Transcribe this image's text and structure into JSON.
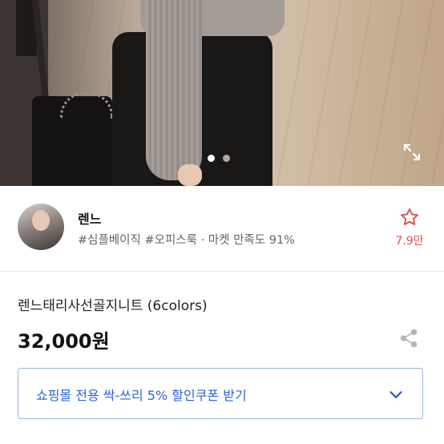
{
  "carousel": {
    "total": 2,
    "active": 1,
    "active_color": "#ffffff",
    "inactive_color": "#b4aaa0"
  },
  "store": {
    "name": "렌느",
    "tags": "#심플베이직 #오피스룩 · 마켓 만족도 91%",
    "favorite_count": "7.9만",
    "favorite_color": "#d9534f"
  },
  "product": {
    "title": "렌느태리사선골지니트 (6colors)",
    "price": "32,000원"
  },
  "coupon": {
    "label": "쇼핑몰 전용 싹-쓰리 5% 할인쿠폰 받기",
    "accent_color": "#2b64d8"
  },
  "icons": {
    "expand": "expand-icon",
    "favorite": "star-outline-icon",
    "share": "share-icon",
    "dropdown": "chevron-down-icon"
  }
}
